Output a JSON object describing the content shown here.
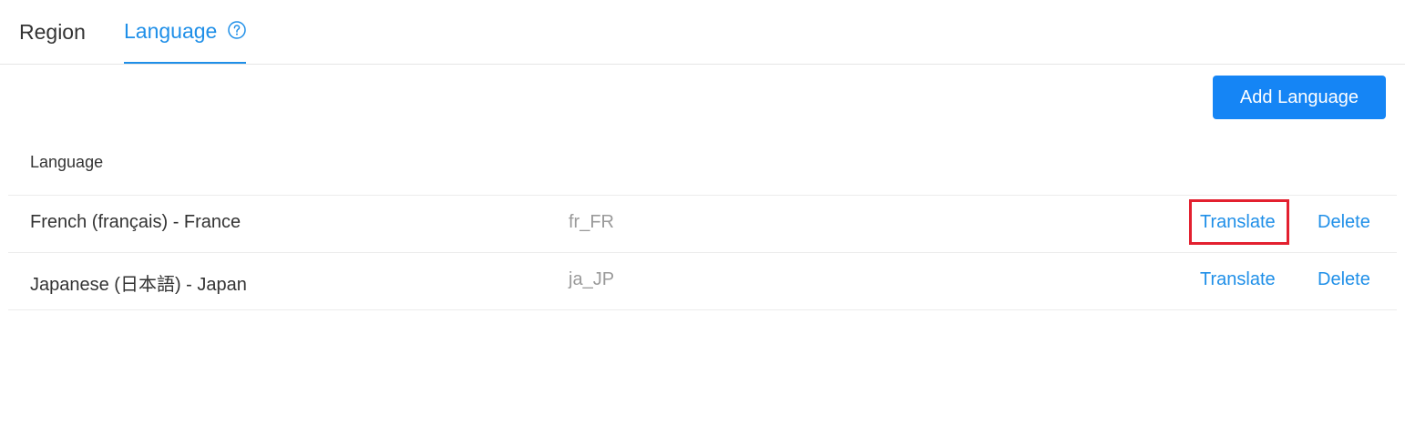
{
  "tabs": [
    {
      "label": "Region",
      "active": false
    },
    {
      "label": "Language",
      "active": true
    }
  ],
  "help_icon": "question-circle-icon",
  "add_button_label": "Add Language",
  "table": {
    "header": "Language",
    "rows": [
      {
        "name": "French (français) - France",
        "code": "fr_FR",
        "translate": "Translate",
        "delete": "Delete"
      },
      {
        "name": "Japanese (日本語) - Japan",
        "code": "ja_JP",
        "translate": "Translate",
        "delete": "Delete"
      }
    ]
  },
  "colors": {
    "accent": "#1f8fe8",
    "button_bg": "#1585f5",
    "highlight": "#e3202f",
    "muted_text": "#9a9a9a"
  }
}
